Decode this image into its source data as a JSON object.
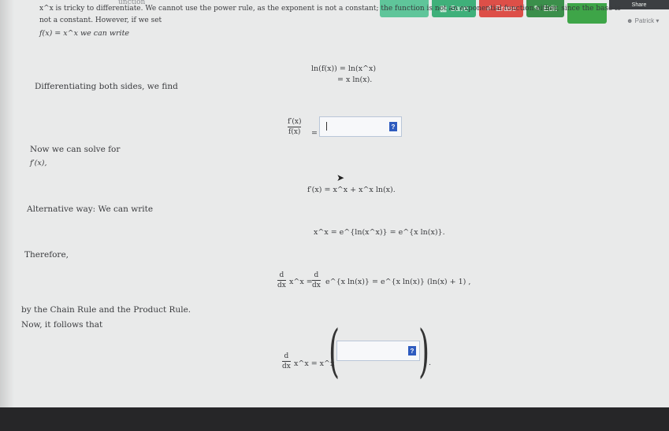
{
  "toolbar": {
    "save_label": "Save",
    "erase_label": "Erase",
    "edit_label": "Edit",
    "dark_label": "Share",
    "user_label": "Patrick"
  },
  "header": {
    "faded_title": "unction"
  },
  "content": {
    "intro_line1": "x^x is tricky to differentiate. We cannot use the power rule, as the exponent is not a constant; the function is not an exponential function either, since the base is",
    "intro_line2": "not a constant. However, if we set",
    "intro_line3": "f(x) = x^x we can write",
    "eq1_line1": "ln(f(x)) = ln(x^x)",
    "eq1_line2": "= x ln(x).",
    "diff_text": "Differentiating both sides, we find",
    "frac_num": "f′(x)",
    "frac_den": "f(x)",
    "eq_sign": "=",
    "solve_text_line1": "Now we can solve for",
    "solve_text_line2": "f′(x),",
    "eq2": "f′(x) = x^x + x^x ln(x).",
    "alt_text": "Alternative way: We can write",
    "eq3": "x^x = e^{ln(x^x)} = e^{x ln(x)}.",
    "therefore_text": "Therefore,",
    "eq4_d": "d",
    "eq4_dx": "dx",
    "eq4_part1": "x^x =",
    "eq4_part2": "e^{x ln(x)} = e^{x ln(x)} (ln(x) + 1) ,",
    "chain_text": "by the Chain Rule and the Product Rule.",
    "follows_text": "Now, it follows that",
    "eq5_part": "x^x = x^x",
    "answer_1": "",
    "answer_2": "",
    "q_label": "?"
  }
}
